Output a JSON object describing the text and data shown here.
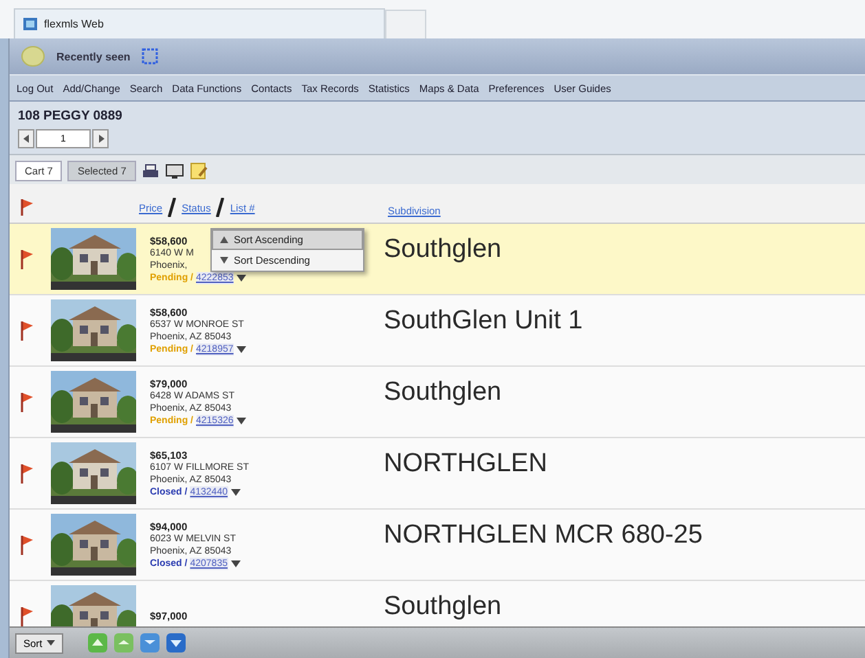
{
  "browser_tab": {
    "title": "flexmls Web"
  },
  "header": {
    "title": "Recently seen"
  },
  "menu": [
    "Log Out",
    "Add/Change",
    "Search",
    "Data Functions",
    "Contacts",
    "Tax Records",
    "Statistics",
    "Maps & Data",
    "Preferences",
    "User Guides"
  ],
  "listing_title": "108 PEGGY 0889",
  "pager": {
    "page": "1"
  },
  "tabs": [
    {
      "label": "Cart 7",
      "selected": true
    },
    {
      "label": "Selected 7",
      "selected": false
    }
  ],
  "columns": {
    "sort_links": [
      "Price",
      "Status",
      "List #"
    ],
    "subdivision": "Subdivision"
  },
  "sort_menu": {
    "items": [
      {
        "label": "Sort Ascending",
        "selected": true
      },
      {
        "label": "Sort Descending",
        "selected": false
      }
    ]
  },
  "rows": [
    {
      "selected": true,
      "price": "$58,600",
      "address": "6140 W M",
      "city": "Phoenix,",
      "status": {
        "label": "Pending /",
        "color": "#e0a000"
      },
      "list_number": "4222853",
      "subdivision": "Southglen"
    },
    {
      "selected": false,
      "price": "$58,600",
      "address": "6537 W MONROE ST",
      "city": "Phoenix, AZ 85043",
      "status": {
        "label": "Pending /",
        "color": "#e0a000"
      },
      "list_number": "4218957",
      "subdivision": "SouthGlen Unit 1"
    },
    {
      "selected": false,
      "price": "$79,000",
      "address": "6428 W ADAMS ST",
      "city": "Phoenix, AZ 85043",
      "status": {
        "label": "Pending /",
        "color": "#e0a000"
      },
      "list_number": "4215326",
      "subdivision": "Southglen"
    },
    {
      "selected": false,
      "price": "$65,103",
      "address": "6107 W FILLMORE ST",
      "city": "Phoenix, AZ 85043",
      "status": {
        "label": "Closed /",
        "color": "#2a3bb0"
      },
      "list_number": "4132440",
      "subdivision": "NORTHGLEN"
    },
    {
      "selected": false,
      "price": "$94,000",
      "address": "6023 W MELVIN ST",
      "city": "Phoenix, AZ 85043",
      "status": {
        "label": "Closed /",
        "color": "#2a3bb0"
      },
      "list_number": "4207835",
      "subdivision": "NORTHGLEN MCR 680-25"
    },
    {
      "selected": false,
      "price": "$97,000",
      "subdivision": "Southglen"
    }
  ],
  "bottom_bar": {
    "sort_button": "Sort"
  }
}
